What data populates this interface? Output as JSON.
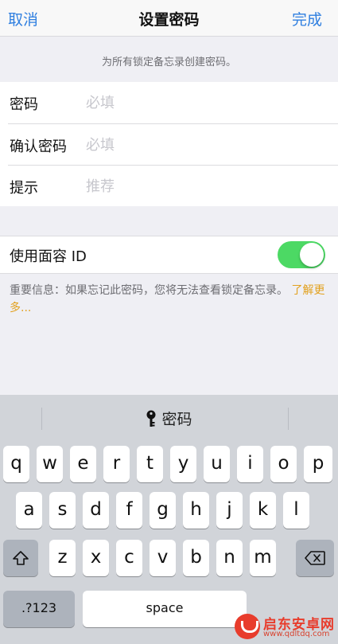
{
  "nav": {
    "cancel": "取消",
    "title": "设置密码",
    "done": "完成"
  },
  "banner": "为所有锁定备忘录创建密码。",
  "form": {
    "password_label": "密码",
    "password_placeholder": "必填",
    "confirm_label": "确认密码",
    "confirm_placeholder": "必填",
    "hint_label": "提示",
    "hint_placeholder": "推荐"
  },
  "face_id": {
    "label": "使用面容 ID",
    "enabled": true
  },
  "notice": {
    "text": "重要信息：如果忘记此密码，您将无法查看锁定备忘录。",
    "link": "了解更多..."
  },
  "keyboard": {
    "suggestion": "密码",
    "row1": [
      "q",
      "w",
      "e",
      "r",
      "t",
      "y",
      "u",
      "i",
      "o",
      "p"
    ],
    "row2": [
      "a",
      "s",
      "d",
      "f",
      "g",
      "h",
      "j",
      "k",
      "l"
    ],
    "row3": [
      "z",
      "x",
      "c",
      "v",
      "b",
      "n",
      "m"
    ],
    "numbers_label": ".?123",
    "space_label": "space"
  },
  "watermark": {
    "name": "启东安卓网",
    "url": "www.qdltdq.com"
  },
  "colors": {
    "accent": "#2f7fe0",
    "toggle_on": "#4cd964",
    "link": "#e2a11e"
  }
}
